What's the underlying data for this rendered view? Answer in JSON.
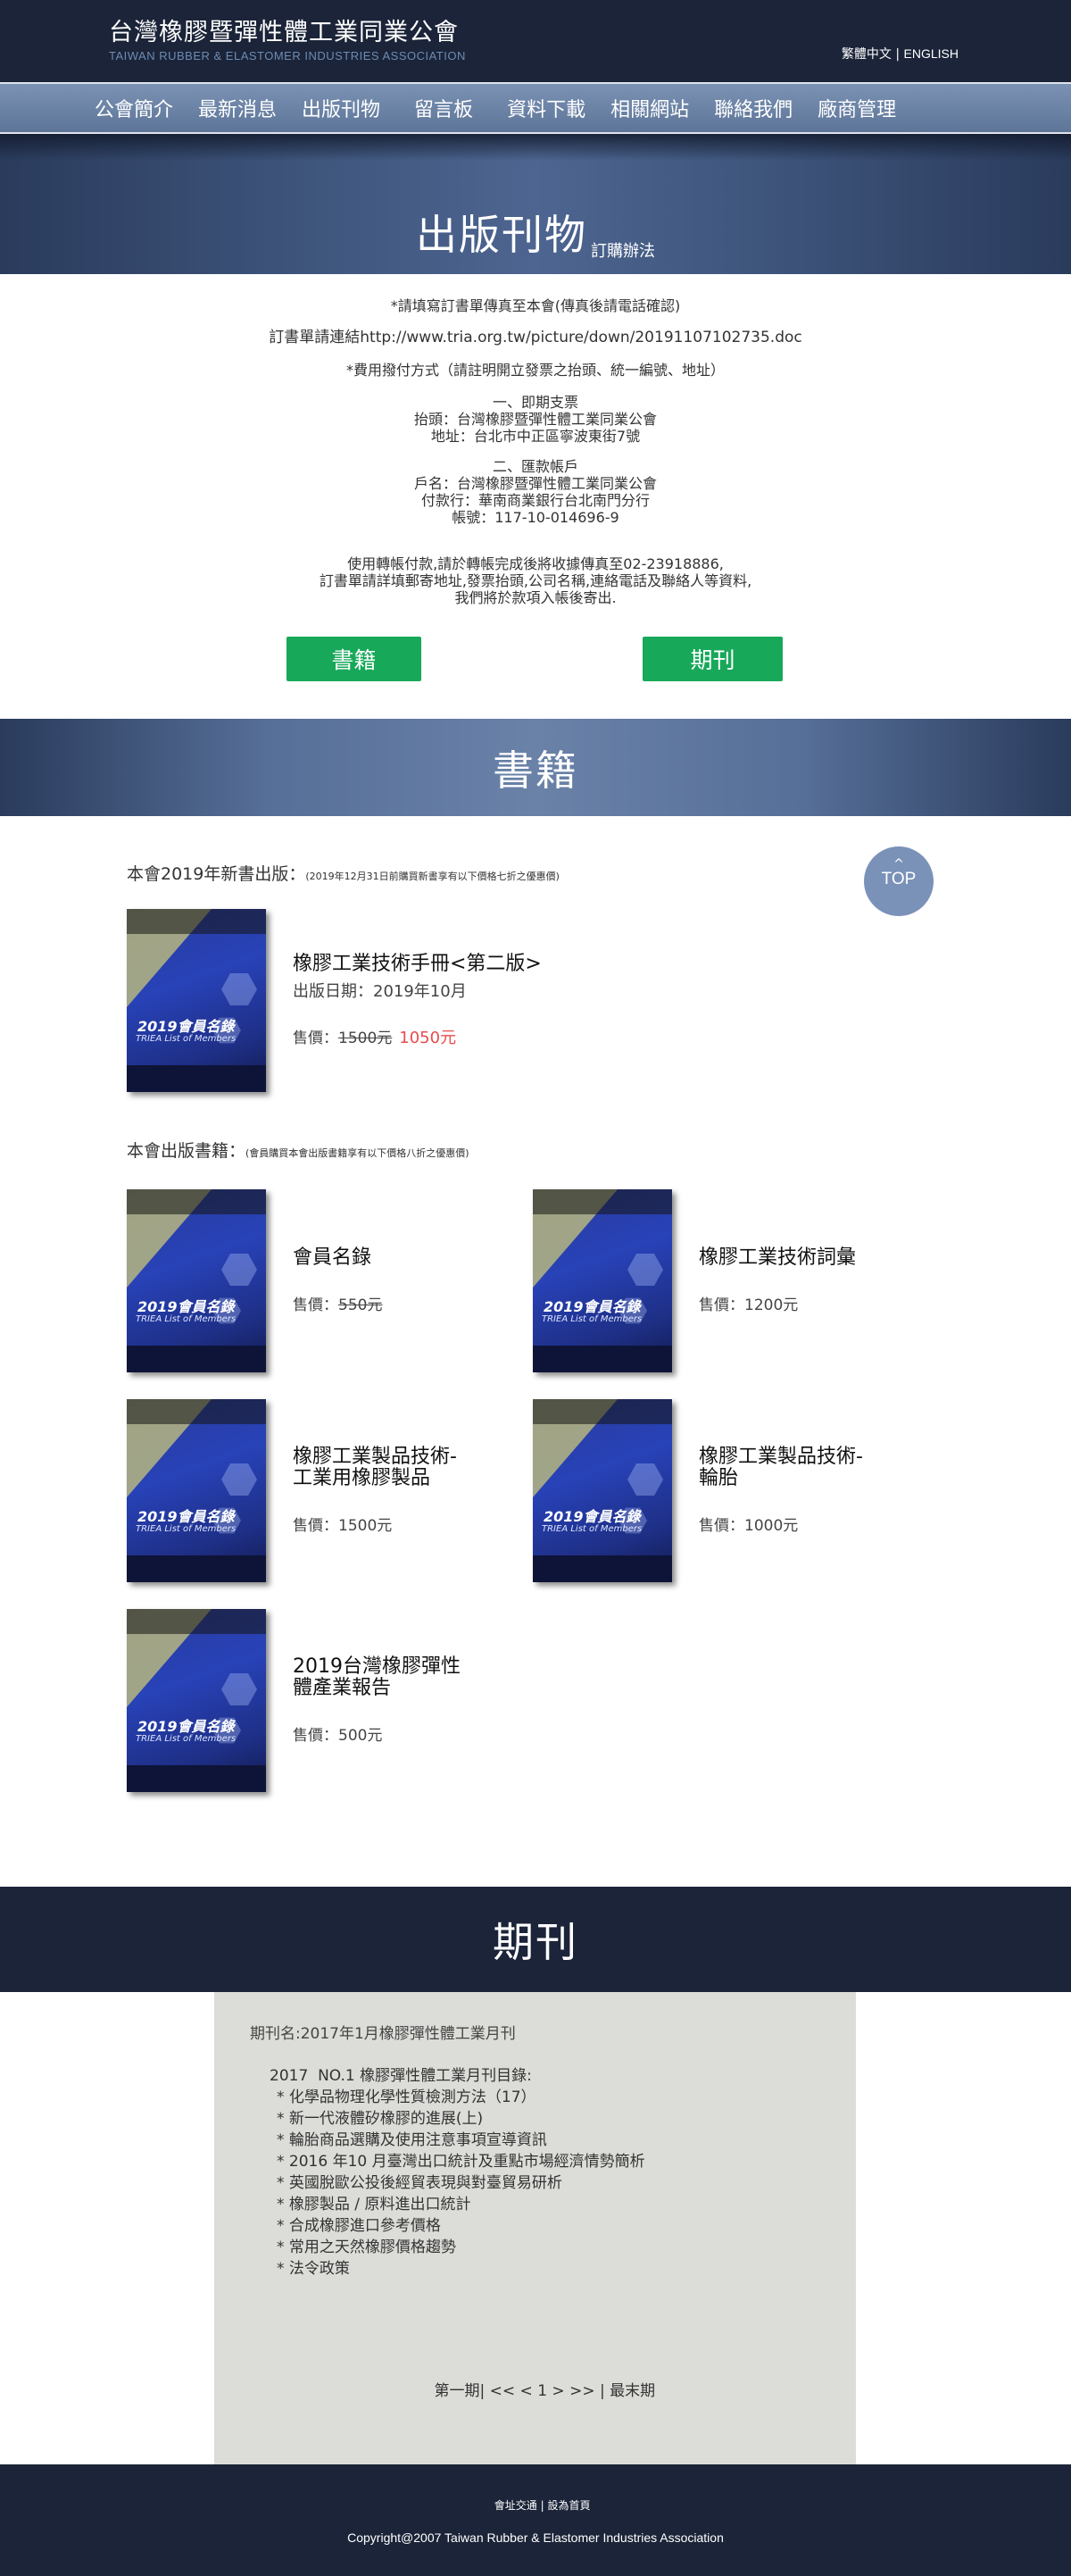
{
  "header": {
    "title": "台灣橡膠暨彈性體工業同業公會",
    "subtitle": "TAIWAN RUBBER & ELASTOMER INDUSTRIES ASSOCIATION",
    "lang_zh": "繁體中文",
    "lang_sep": " | ",
    "lang_en": "ENGLISH"
  },
  "nav": {
    "items": [
      "公會簡介",
      "最新消息",
      "出版刊物",
      "留言板",
      "資料下載",
      "相關網站",
      "聯絡我們",
      "廠商管理"
    ]
  },
  "banner": {
    "title": "出版刊物",
    "subtitle": "訂購辦法"
  },
  "order": {
    "line1": "*請填寫訂書單傳真至本會(傳真後請電話確認)",
    "line2": "訂書單請連結http://www.tria.org.tw/picture/down/20191107102735.doc",
    "line3": "*費用撥付方式（請註明開立發票之抬頭、統一編號、地址）",
    "check_title": "一、即期支票",
    "check_payee": "抬頭：台灣橡膠暨彈性體工業同業公會",
    "check_address": "地址：台北市中正區寧波東街7號",
    "transfer_title": "二、匯款帳戶",
    "transfer_name": "戶名：台灣橡膠暨彈性體工業同業公會",
    "transfer_bank": "付款行：華南商業銀行台北南門分行",
    "transfer_account": "帳號：117-10-014696-9",
    "note1": "使用轉帳付款,請於轉帳完成後將收據傳真至02-23918886,",
    "note2": "訂書單請詳填郵寄地址,發票抬頭,公司名稱,連絡電話及聯絡人等資料,",
    "note3": "我們將於款項入帳後寄出."
  },
  "buttons": {
    "books": "書籍",
    "journals": "期刊"
  },
  "books_section": {
    "title": "書籍",
    "top_arrow": "^",
    "top_label": "TOP",
    "new_title": "本會2019年新書出版：",
    "new_note": "(2019年12月31日前購買新書享有以下價格七折之優惠價)",
    "featured": {
      "title": "橡膠工業技術手冊<第二版>",
      "date": "出版日期：2019年10月",
      "price_label": "售價：",
      "old_price": "1500元",
      "sale_price": "1050元"
    },
    "pub_title": "本會出版書籍：",
    "pub_note": "(會員購買本會出版書籍享有以下價格八折之優惠價)",
    "cover_year": "2019會員名錄",
    "cover_line": "TRIEA List of Members",
    "items": [
      {
        "title1": "會員名錄",
        "title2": "",
        "price_label": "售價：",
        "price": "550元"
      },
      {
        "title1": "橡膠工業技術詞彙",
        "title2": "",
        "price_label": "售價：",
        "price": "1200元"
      },
      {
        "title1": "橡膠工業製品技術-",
        "title2": "工業用橡膠製品",
        "price_label": "售價：",
        "price": "1500元"
      },
      {
        "title1": "橡膠工業製品技術-",
        "title2": "輪胎",
        "price_label": "售價：",
        "price": "1000元"
      },
      {
        "title1": "2019台灣橡膠彈性",
        "title2": "體產業報告",
        "price_label": "售價：",
        "price": "500元"
      }
    ]
  },
  "journal_section": {
    "title": "期刊",
    "name": "期刊名:2017年1月橡膠彈性體工業月刊",
    "heading": "2017  NO.1 橡膠彈性體工業月刊目錄:",
    "items": [
      "* 化學品物理化學性質檢測方法（17）",
      "* 新一代液體矽橡膠的進展(上)",
      "* 輪胎商品選購及使用注意事項宣導資訊",
      "* 2016 年10 月臺灣出口統計及重點市場經濟情勢簡析",
      "* 英國脫歐公投後經貿表現與對臺貿易研析",
      "* 橡膠製品 / 原料進出口統計",
      "* 合成橡膠進口參考價格",
      "* 常用之天然橡膠價格趨勢",
      "* 法令政策"
    ],
    "pager": {
      "first": "第一期",
      "sep1": "| ",
      "prev": "<< <",
      "page": "1",
      "next": "> >>",
      "sep2": " | ",
      "last": "最末期"
    }
  },
  "footer": {
    "link1": "會址交通",
    "sep": " | ",
    "link2": "設為首頁",
    "copyright": "Copyright@2007 Taiwan Rubber & Elastomer Industries Association"
  }
}
